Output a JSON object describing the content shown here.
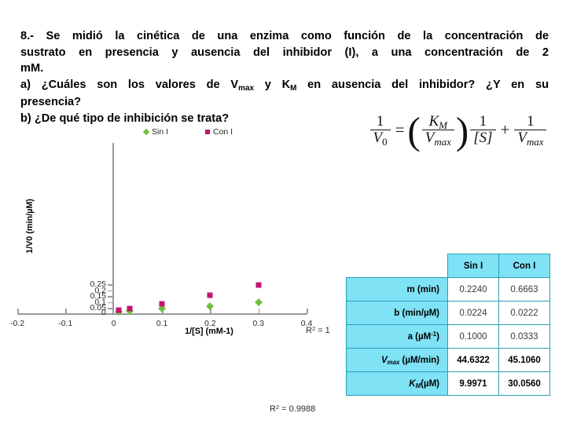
{
  "question": {
    "line1": "8.- Se midió la cinética de una enzima como función de la concentración de",
    "line2": "sustrato en presencia y ausencia del inhibidor (I), a una concentración de 2",
    "line3": "mM.",
    "line4a": "a) ¿Cuáles son los valores de V",
    "line4a_sub": "max",
    "line4b": " y K",
    "line4b_sub": "M",
    "line4c": " en ausencia del inhibidor? ¿Y en su",
    "line5": "presencia?",
    "line6": "b) ¿De qué tipo de inhibición se trata?"
  },
  "formula": {
    "lhs_num": "1",
    "lhs_den_v": "V",
    "lhs_den_sub": "0",
    "equals": "=",
    "paren_open": "(",
    "paren_close": ")",
    "km_num": "K",
    "km_num_sub": "M",
    "km_den": "V",
    "km_den_sub": "max",
    "s_num": "1",
    "s_den": "[S]",
    "plus": "+",
    "vmax_num": "1",
    "vmax_den": "V",
    "vmax_den_sub": "max"
  },
  "chart_data": {
    "type": "scatter",
    "title": "",
    "xlabel": "1/[S] (mM-1)",
    "ylabel": "1/V0 (min/µM)",
    "xlim": [
      -0.2,
      0.4
    ],
    "ylim": [
      0,
      0.25
    ],
    "xticks": [
      "-0.2",
      "-0.1",
      "0",
      "0.1",
      "0.2",
      "0.3",
      "0.4"
    ],
    "xtick_values": [
      -0.2,
      -0.1,
      0,
      0.1,
      0.2,
      0.3,
      0.4
    ],
    "yticks": [
      "0",
      "0.05",
      "0.1",
      "0.15",
      "0.2",
      "0.25"
    ],
    "ytick_values": [
      0,
      0.05,
      0.1,
      0.15,
      0.2,
      0.25
    ],
    "grid": false,
    "legend_position": "top-right",
    "origin_label": "0",
    "series": [
      {
        "name": "Sin I",
        "marker": "diamond",
        "color": "#6FBF3F",
        "x": [
          0.01,
          0.033,
          0.1,
          0.2,
          0.3
        ],
        "y": [
          0.023,
          0.029,
          0.045,
          0.069,
          0.096
        ]
      },
      {
        "name": "Con I",
        "marker": "square",
        "color": "#C3156F",
        "x": [
          0.01,
          0.033,
          0.1,
          0.2,
          0.3
        ],
        "y": [
          0.03,
          0.045,
          0.088,
          0.156,
          0.244
        ]
      }
    ],
    "annotations": [
      {
        "id": "r2-con-i",
        "text": "R2 = 1",
        "base": "R",
        "sup": "2",
        "rest": " = 1"
      },
      {
        "id": "r2-sin-i",
        "text": "R2 = 0.9988",
        "base": "R",
        "sup": "2",
        "rest": " = 0.9988"
      }
    ]
  },
  "results_table": {
    "corner": "",
    "columns": [
      "Sin I",
      "Con I"
    ],
    "rows": [
      {
        "label": "m (min)",
        "sin_i": "0.2240",
        "con_i": "0.6663",
        "emphasis": "light"
      },
      {
        "label": "b (min/µM)",
        "sin_i": "0.0224",
        "con_i": "0.0222",
        "emphasis": "light"
      },
      {
        "label": "a (µM-1)",
        "sin_i": "0.1000",
        "con_i": "0.0333",
        "emphasis": "light"
      },
      {
        "label": "Vmax (µM/min)",
        "sin_i": "44.6322",
        "con_i": "45.1060",
        "emphasis": "bold"
      },
      {
        "label": "KM (µM)",
        "sin_i": "9.9971",
        "con_i": "30.0560",
        "emphasis": "bold"
      }
    ],
    "row_label_parts": [
      {
        "main": "m (min)",
        "italic": "",
        "sub": "",
        "tail": ""
      },
      {
        "main": "b (min/µM)",
        "italic": "",
        "sub": "",
        "tail": ""
      },
      {
        "main": "a (µM",
        "italic": "",
        "sub": "",
        "tail": ")"
      },
      {
        "main": "",
        "italic": "V",
        "sub": "max",
        "tail": " (µM/min)"
      },
      {
        "main": "",
        "italic": "K",
        "sub": "M",
        "tail": "(µM)"
      }
    ],
    "header_bg": "#7fe2f5",
    "border_color": "#2a9fb5"
  }
}
